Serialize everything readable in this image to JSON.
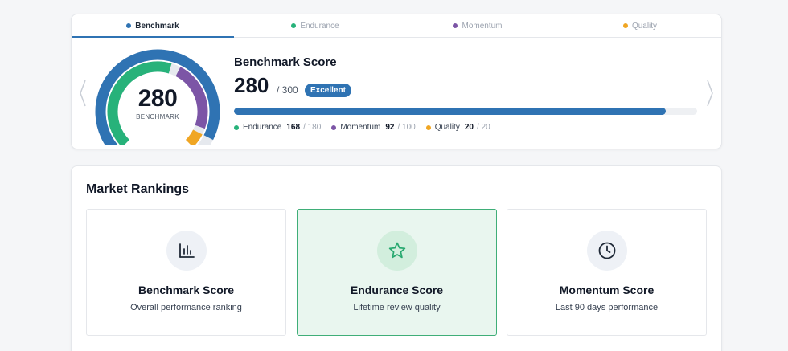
{
  "colors": {
    "benchmark": "#2f73b3",
    "endurance": "#27b27a",
    "momentum": "#7c55a6",
    "quality": "#f0a623"
  },
  "tabs": [
    {
      "label": "Benchmark",
      "color": "#2f73b3",
      "active": true
    },
    {
      "label": "Endurance",
      "color": "#27b27a",
      "active": false
    },
    {
      "label": "Momentum",
      "color": "#7c55a6",
      "active": false
    },
    {
      "label": "Quality",
      "color": "#f0a623",
      "active": false
    }
  ],
  "gauge": {
    "value": "280",
    "label": "BENCHMARK",
    "max": 300,
    "segments": [
      {
        "name": "Endurance",
        "value": 168,
        "max": 180
      },
      {
        "name": "Momentum",
        "value": 92,
        "max": 100
      },
      {
        "name": "Quality",
        "value": 20,
        "max": 20
      }
    ]
  },
  "score": {
    "title": "Benchmark Score",
    "value": "280",
    "max_text": "/ 300",
    "badge": "Excellent",
    "progress_fraction": 0.933
  },
  "breakdown": [
    {
      "label": "Endurance",
      "value": "168",
      "max": "/ 180",
      "color": "#27b27a"
    },
    {
      "label": "Momentum",
      "value": "92",
      "max": "/ 100",
      "color": "#7c55a6"
    },
    {
      "label": "Quality",
      "value": "20",
      "max": "/ 20",
      "color": "#f0a623"
    }
  ],
  "rankings": {
    "title": "Market Rankings",
    "cards": [
      {
        "title": "Benchmark Score",
        "desc": "Overall performance ranking",
        "icon": "bar-chart-icon",
        "selected": false
      },
      {
        "title": "Endurance Score",
        "desc": "Lifetime review quality",
        "icon": "star-icon",
        "selected": true
      },
      {
        "title": "Momentum Score",
        "desc": "Last 90 days performance",
        "icon": "clock-icon",
        "selected": false
      }
    ]
  }
}
